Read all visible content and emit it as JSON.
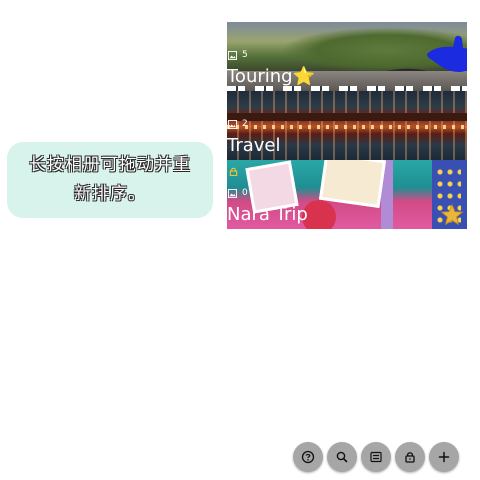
{
  "tip": {
    "text": "长按相册可拖动并重新排序。"
  },
  "albums": [
    {
      "title": "Touring⭐",
      "count": "5",
      "locked": false
    },
    {
      "title": "Travel",
      "count": "2",
      "locked": false
    },
    {
      "title": "Nara Trip",
      "count": "0",
      "locked": true
    }
  ],
  "toolbar": {
    "buttons": [
      {
        "name": "help",
        "icon": "question-icon"
      },
      {
        "name": "search",
        "icon": "search-icon"
      },
      {
        "name": "view-mode",
        "icon": "card-list-icon"
      },
      {
        "name": "lock",
        "icon": "lock-icon"
      },
      {
        "name": "add",
        "icon": "plus-icon"
      }
    ]
  },
  "colors": {
    "tip_background": "#d7f3ec",
    "fab_background": "#a6a6a6",
    "hand_accent": "#1a2be0",
    "lock_accent": "#f4c430"
  }
}
